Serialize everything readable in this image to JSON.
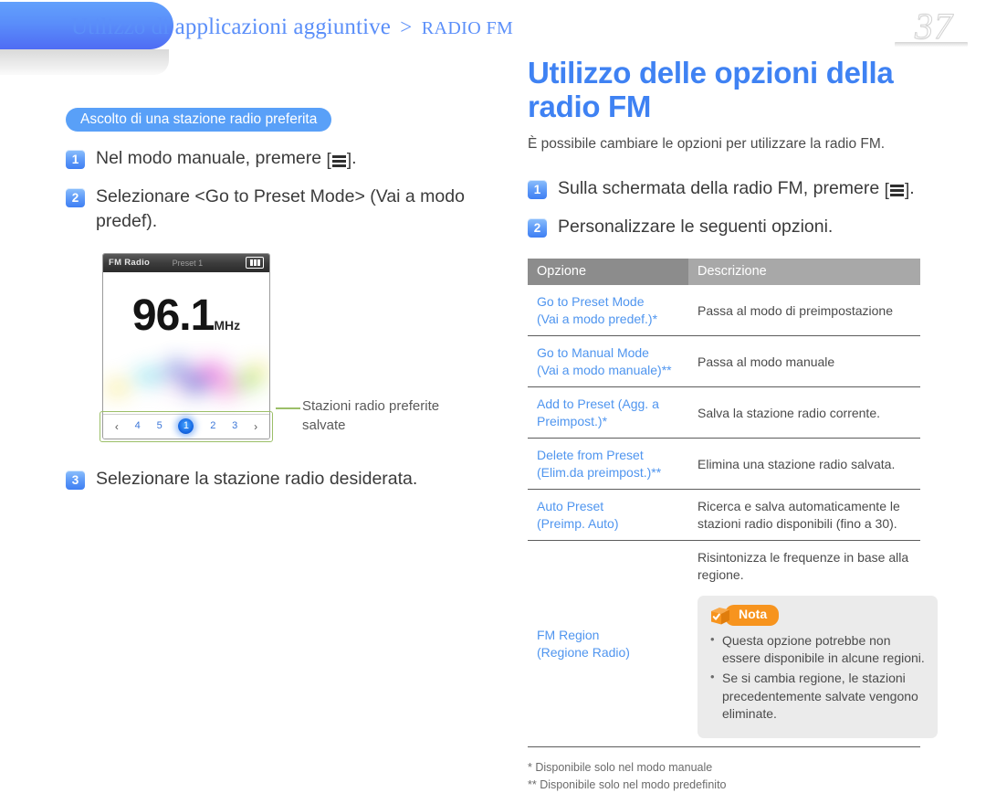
{
  "header": {
    "breadcrumb_main": "Utilizzo di applicazioni aggiuntive",
    "breadcrumb_sep": ">",
    "breadcrumb_section": "RADIO FM",
    "page_number": "37"
  },
  "left_column": {
    "section_pill": "Ascolto di una stazione radio preferita",
    "steps": [
      {
        "num": "1",
        "text_before": "Nel modo manuale, premere ",
        "key_icon": "menu-key",
        "text_after": "."
      },
      {
        "num": "2",
        "text_before": "Selezionare <Go to Preset Mode> (Vai a modo predef).",
        "key_icon": "",
        "text_after": ""
      },
      {
        "num": "3",
        "text_before": "Selezionare la stazione radio desiderata.",
        "key_icon": "",
        "text_after": ""
      }
    ],
    "device": {
      "status_title": "FM Radio",
      "status_preset": "Preset 1",
      "battery_icon": "battery-full-icon",
      "frequency": "96.1",
      "frequency_unit": "MHz",
      "preset_prev": "‹",
      "preset_next": "›",
      "presets": [
        "4",
        "5",
        "1",
        "2",
        "3"
      ],
      "active_preset": "1"
    },
    "callout": {
      "line1": "Stazioni radio preferite",
      "line2": "salvate"
    }
  },
  "right_column": {
    "title": "Utilizzo delle opzioni della radio FM",
    "intro": "È possibile cambiare le opzioni per utilizzare la radio FM.",
    "steps": [
      {
        "num": "1",
        "text_before": "Sulla schermata della radio FM, premere ",
        "key_icon": "menu-key",
        "text_after": "."
      },
      {
        "num": "2",
        "text_before": "Personalizzare le seguenti opzioni.",
        "key_icon": "",
        "text_after": ""
      }
    ],
    "table": {
      "header_option": "Opzione",
      "header_description": "Descrizione",
      "rows": [
        {
          "option_line1": "Go to Preset Mode",
          "option_line2": "(Vai a modo predef.)*",
          "description": "Passa al modo di preimpostazione"
        },
        {
          "option_line1": "Go to Manual Mode",
          "option_line2": "(Vai a modo manuale)**",
          "description": "Passa al modo manuale"
        },
        {
          "option_line1": "Add to Preset (Agg. a",
          "option_line2": "Preimpost.)*",
          "description": "Salva la stazione radio corrente."
        },
        {
          "option_line1": "Delete from Preset",
          "option_line2": "(Elim.da preimpost.)**",
          "description": "Elimina una stazione radio salvata."
        },
        {
          "option_line1": "Auto Preset",
          "option_line2": "(Preimp. Auto)",
          "description": "Ricerca e salva automaticamente le stazioni radio disponibili (fino a 30)."
        }
      ],
      "region_row": {
        "option_line1": "FM Region",
        "option_line2": "(Regione Radio)",
        "description": "Risintonizza le frequenze in base alla regione."
      }
    },
    "nota": {
      "icon": "note-cube-icon",
      "label": "Nota",
      "items": [
        "Questa opzione potrebbe non essere disponibile in alcune regioni.",
        "Se si cambia regione, le stazioni precedentemente salvate vengono eliminate."
      ]
    },
    "footnotes": [
      "* Disponibile solo nel modo manuale",
      "** Disponibile solo nel modo predefinito"
    ]
  },
  "colors": {
    "accent_blue": "#4f95ef",
    "title_blue": "#3f82f3",
    "pill_blue": "#59a0f8",
    "nota_orange": "#f7941e",
    "callout_green": "#9cbf68",
    "table_header_dark": "#8c8c8c",
    "table_header_light": "#a8a8a8"
  }
}
